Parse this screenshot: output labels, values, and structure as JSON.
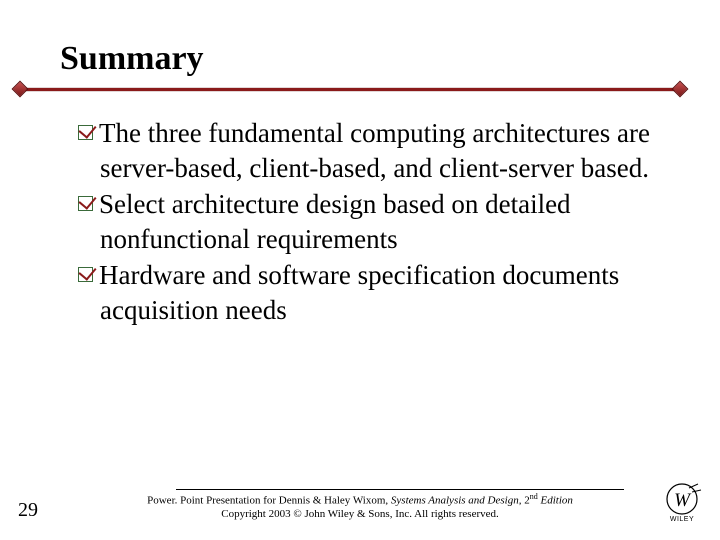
{
  "title": "Summary",
  "bullets": [
    "The three fundamental computing architectures are server-based, client-based, and client-server based.",
    "Select architecture design based on detailed nonfunctional requirements",
    "Hardware and software specification documents acquisition needs"
  ],
  "page_number": "29",
  "credit_line1_a": "Power. Point Presentation for Dennis & Haley Wixom, ",
  "credit_line1_b": "Systems Analysis and Design, ",
  "credit_line1_c": "2",
  "credit_line1_d": "nd",
  "credit_line1_e": " Edition",
  "credit_line2": "Copyright 2003 © John Wiley & Sons, Inc.  All rights reserved.",
  "logo_text": "WILEY"
}
